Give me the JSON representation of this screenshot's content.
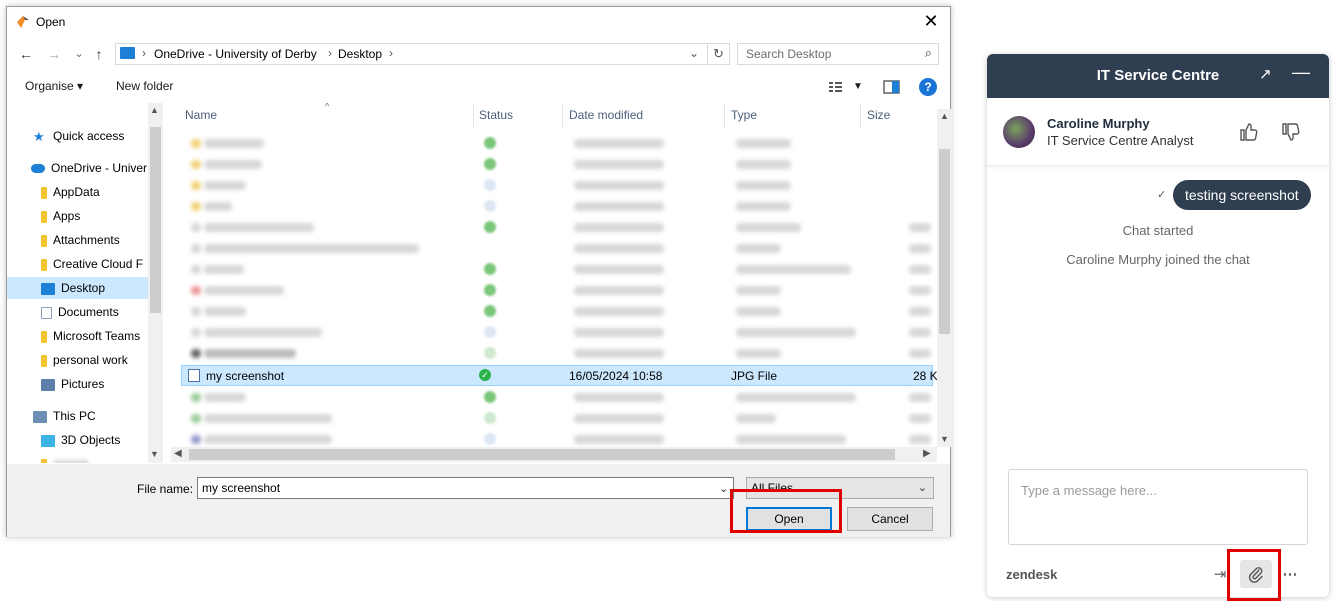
{
  "dialog": {
    "title": "Open",
    "close_glyph": "✕",
    "nav": {
      "back": "←",
      "forward": "→",
      "recent": "⌄",
      "up": "↑"
    },
    "breadcrumb": [
      "OneDrive - University of Derby",
      "Desktop"
    ],
    "search_placeholder": "Search Desktop",
    "toolbar": {
      "organise": "Organise ▾",
      "new_folder": "New folder"
    },
    "nav_pane": [
      {
        "label": "Quick access",
        "icon": "star-icon",
        "color": "#1e7fd6"
      },
      {
        "label": "OneDrive - Univer",
        "icon": "cloud-icon",
        "color": "#1e7fd6"
      },
      {
        "label": "AppData",
        "icon": "folder-icon",
        "color": "#f4c430"
      },
      {
        "label": "Apps",
        "icon": "folder-icon",
        "color": "#f4c430"
      },
      {
        "label": "Attachments",
        "icon": "folder-icon",
        "color": "#f4c430"
      },
      {
        "label": "Creative Cloud F",
        "icon": "folder-icon",
        "color": "#f4c430"
      },
      {
        "label": "Desktop",
        "icon": "desktop-icon",
        "color": "#1e7fd6",
        "selected": true
      },
      {
        "label": "Documents",
        "icon": "document-icon",
        "color": "#8aa0b8"
      },
      {
        "label": "Microsoft Teams",
        "icon": "folder-icon",
        "color": "#f4c430"
      },
      {
        "label": "personal work",
        "icon": "folder-icon",
        "color": "#f4c430"
      },
      {
        "label": "Pictures",
        "icon": "pictures-icon",
        "color": "#5a7fa8"
      },
      {
        "label": "This PC",
        "icon": "computer-icon",
        "color": "#6c8fb5"
      },
      {
        "label": "3D Objects",
        "icon": "cube-icon",
        "color": "#3cb4e6"
      },
      {
        "label": "",
        "icon": "folder-icon",
        "color": "#f4c430"
      }
    ],
    "columns": [
      "Name",
      "Status",
      "Date modified",
      "Type",
      "Size"
    ],
    "selected_file": {
      "name": "my screenshot",
      "date": "16/05/2024 10:58",
      "type": "JPG File",
      "size": "28 K"
    },
    "file_name_label": "File name:",
    "file_name_value": "my screenshot",
    "file_type_value": "All Files",
    "open_label": "Open",
    "cancel_label": "Cancel"
  },
  "chat": {
    "title": "IT Service Centre",
    "agent_name": "Caroline Murphy",
    "agent_role": "IT Service Centre Analyst",
    "message": "testing screenshot",
    "system_messages": [
      "Chat started",
      "Caroline Murphy joined the chat"
    ],
    "composer_placeholder": "Type a message here...",
    "brand": "zendesk",
    "header_color": "#2f3e50",
    "highlight_color": "#e00000"
  }
}
